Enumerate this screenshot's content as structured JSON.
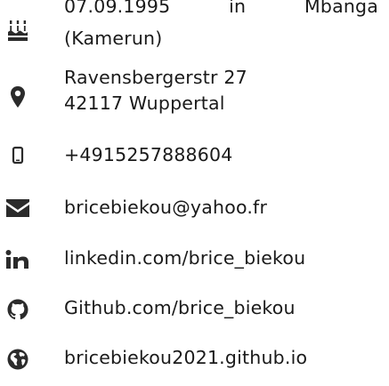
{
  "contact": {
    "birth": {
      "icon": "birthday-cake-icon",
      "date": "07.09.1995",
      "word_in": "in",
      "city": "Mbanga",
      "country": "(Kamerun)"
    },
    "address": {
      "icon": "map-marker-icon",
      "street": "Ravensbergerstr 27",
      "city": "42117 Wuppertal"
    },
    "phone": {
      "icon": "mobile-phone-icon",
      "number": "+4915257888604"
    },
    "email": {
      "icon": "envelope-icon",
      "address": "bricebiekou@yahoo.fr"
    },
    "linkedin": {
      "icon": "linkedin-icon",
      "url": "linkedin.com/brice_biekou"
    },
    "github": {
      "icon": "github-icon",
      "url": "Github.com/brice_biekou"
    },
    "website": {
      "icon": "globe-icon",
      "url": "bricebiekou2021.github.io"
    }
  }
}
